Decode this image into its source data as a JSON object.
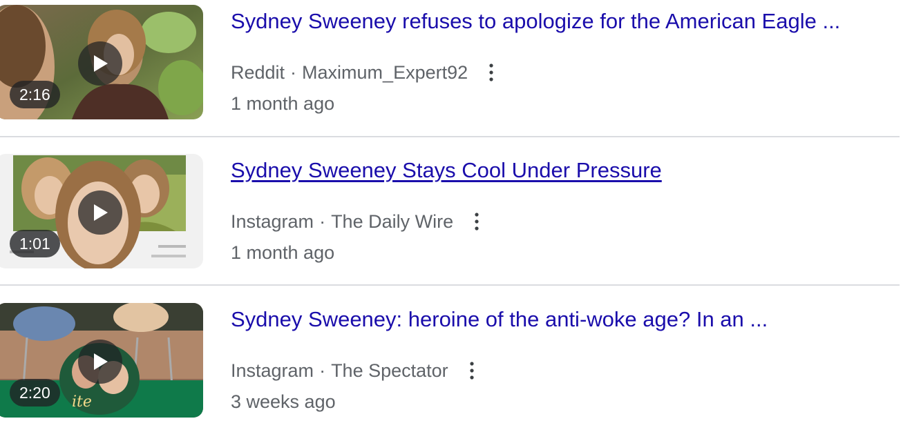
{
  "results": [
    {
      "title": "Sydney Sweeney refuses to apologize for the American Eagle ...",
      "source": "Reddit",
      "author": "Maximum_Expert92",
      "age": "1 month ago",
      "duration": "2:16",
      "underlined": false
    },
    {
      "title": "Sydney Sweeney Stays Cool Under Pressure",
      "source": "Instagram",
      "author": "The Daily Wire",
      "age": "1 month ago",
      "duration": "1:01",
      "underlined": true
    },
    {
      "title": "Sydney Sweeney: heroine of the anti-woke age? In an ...",
      "source": "Instagram",
      "author": "The Spectator",
      "age": "3 weeks ago",
      "duration": "2:20",
      "underlined": false
    }
  ],
  "separator": "·",
  "icons": {
    "play": "play-icon",
    "more": "more-vert-icon"
  },
  "colors": {
    "title_link": "#1a0dab",
    "meta_text": "#5f6368",
    "divider": "#dadce0"
  }
}
